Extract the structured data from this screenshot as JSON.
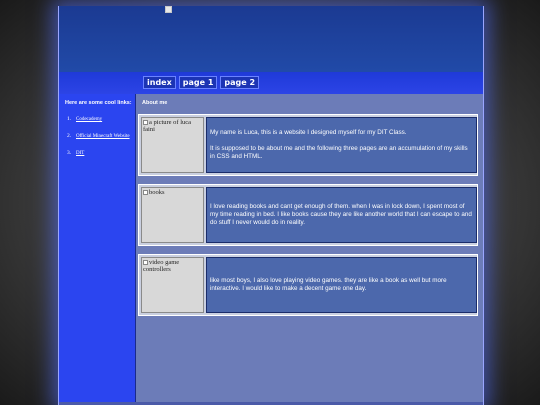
{
  "nav": {
    "links": [
      "index",
      "page 1",
      "page 2"
    ]
  },
  "sidebar": {
    "title": "Here are some cool links:",
    "links": [
      {
        "num": "1.",
        "label": "Codecademy"
      },
      {
        "num": "2.",
        "label": "Official Minecraft Website"
      },
      {
        "num": "3.",
        "label": "DIT"
      }
    ]
  },
  "content": {
    "title": "About me",
    "cards": [
      {
        "img_alt": "a picture of luca faini",
        "paragraphs": [
          "My name is Luca, this is a website I designed myself for my DIT Class.",
          "It is supposed to be about me and the following three pages are an accumulation of my skills in CSS and HTML."
        ]
      },
      {
        "img_alt": "books",
        "paragraphs": [
          "I love reading books and cant get enough of them. when I was in lock down, I spent most of my time reading in bed. I like books cause they are like another world that I can escape to and do stuff I never would do in reality."
        ]
      },
      {
        "img_alt": "video game controllers",
        "paragraphs": [
          "like most boys, I also love playing video games. they are like a book as well but more interactive. I would like to make a decent game one day."
        ]
      }
    ]
  },
  "colors": {
    "page_bg": "#2438d8",
    "header_bg": "#1b3a92",
    "sidebar_bg": "#2b45f0",
    "content_bg": "#6c7cb8",
    "card_text_bg": "#4c68ac"
  }
}
